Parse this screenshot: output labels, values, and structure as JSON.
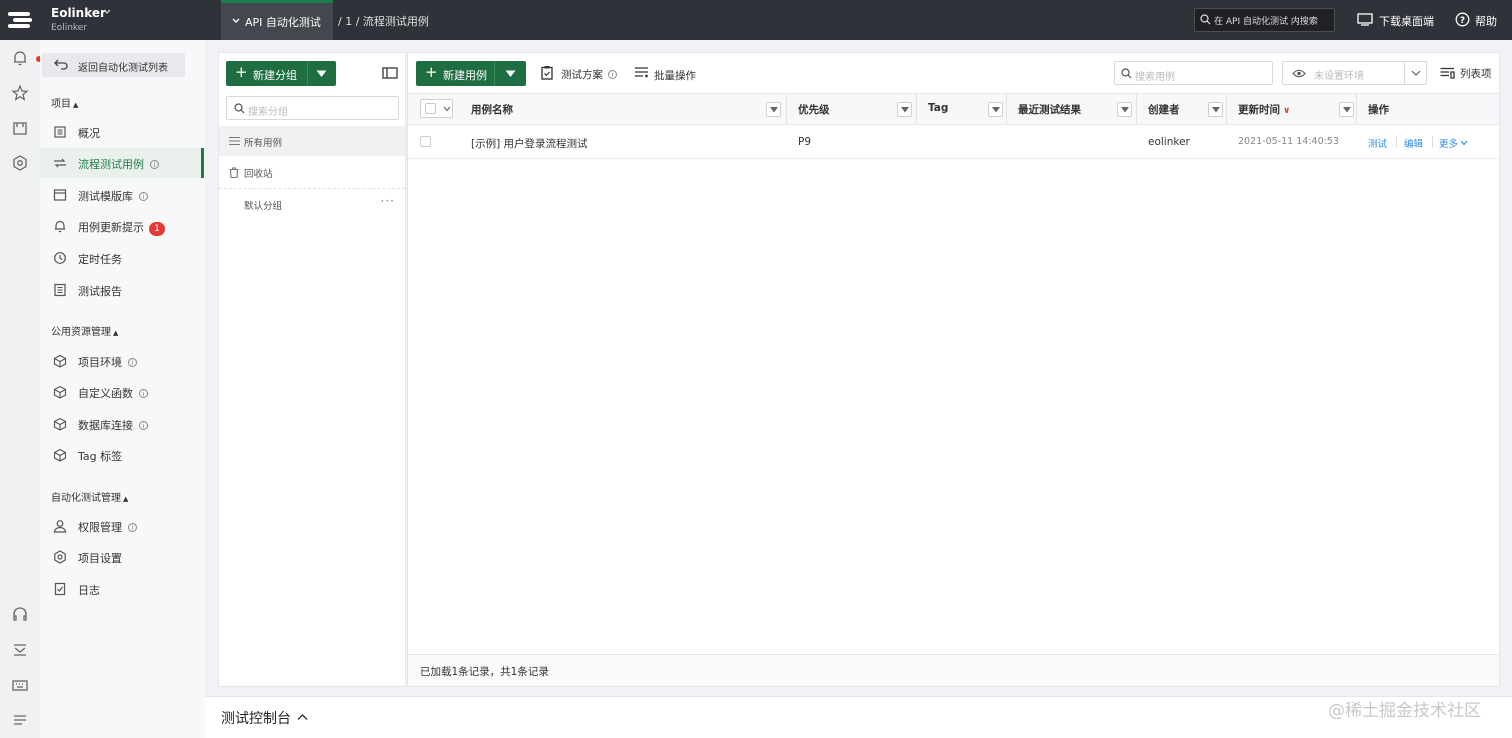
{
  "topbar": {
    "workspace_name": "Eolinker",
    "workspace_sub": "Eolinker",
    "project_tab": "API 自动化测试",
    "breadcrumb": "/ 1 / 流程测试用例",
    "search_placeholder": "在 API 自动化测试 内搜索",
    "download_label": "下载桌面端",
    "help_label": "帮助",
    "accent_color": "#1e7c4a"
  },
  "sidebar": {
    "back_label": "返回自动化测试列表",
    "section_project": "项目",
    "section_public": "公用资源管理",
    "section_auto": "自动化测试管理",
    "items": [
      {
        "label": "概况",
        "icon": "overview-icon"
      },
      {
        "label": "流程测试用例",
        "icon": "flow-icon",
        "active": true
      },
      {
        "label": "测试模版库",
        "icon": "template-icon"
      },
      {
        "label": "用例更新提示",
        "icon": "bell-icon",
        "badge": "1"
      },
      {
        "label": "定时任务",
        "icon": "clock-icon"
      },
      {
        "label": "测试报告",
        "icon": "report-icon"
      },
      {
        "label": "项目环境",
        "icon": "cube-icon"
      },
      {
        "label": "自定义函数",
        "icon": "cube-icon"
      },
      {
        "label": "数据库连接",
        "icon": "cube-icon"
      },
      {
        "label": "Tag 标签",
        "icon": "cube-icon"
      },
      {
        "label": "权限管理",
        "icon": "user-icon"
      },
      {
        "label": "项目设置",
        "icon": "gear-icon"
      },
      {
        "label": "日志",
        "icon": "log-icon"
      }
    ]
  },
  "groups": {
    "new_group_label": "新建分组",
    "search_placeholder": "搜索分组",
    "items": [
      "所有用例",
      "回收站",
      "默认分组"
    ]
  },
  "toolbar": {
    "new_case_label": "新建用例",
    "test_plan_label": "测试方案",
    "batch_label": "批量操作",
    "search_placeholder": "搜索用例",
    "env_placeholder": "未设置环境",
    "columns_label": "列表项"
  },
  "table": {
    "headers": {
      "name": "用例名称",
      "priority": "优先级",
      "tag": "Tag",
      "last_result": "最近测试结果",
      "creator": "创建者",
      "updated": "更新时间",
      "actions": "操作"
    },
    "sort_indicator": "∨",
    "rows": [
      {
        "name": "[示例] 用户登录流程测试",
        "priority": "P9",
        "tag": "",
        "last_result": "",
        "creator": "eolinker",
        "updated": "2021-05-11 14:40:53"
      }
    ],
    "row_actions": {
      "test": "测试",
      "edit": "编辑",
      "more": "更多"
    },
    "footer": "已加载1条记录，共1条记录"
  },
  "console": {
    "label": "测试控制台"
  },
  "watermark": "@稀土掘金技术社区"
}
